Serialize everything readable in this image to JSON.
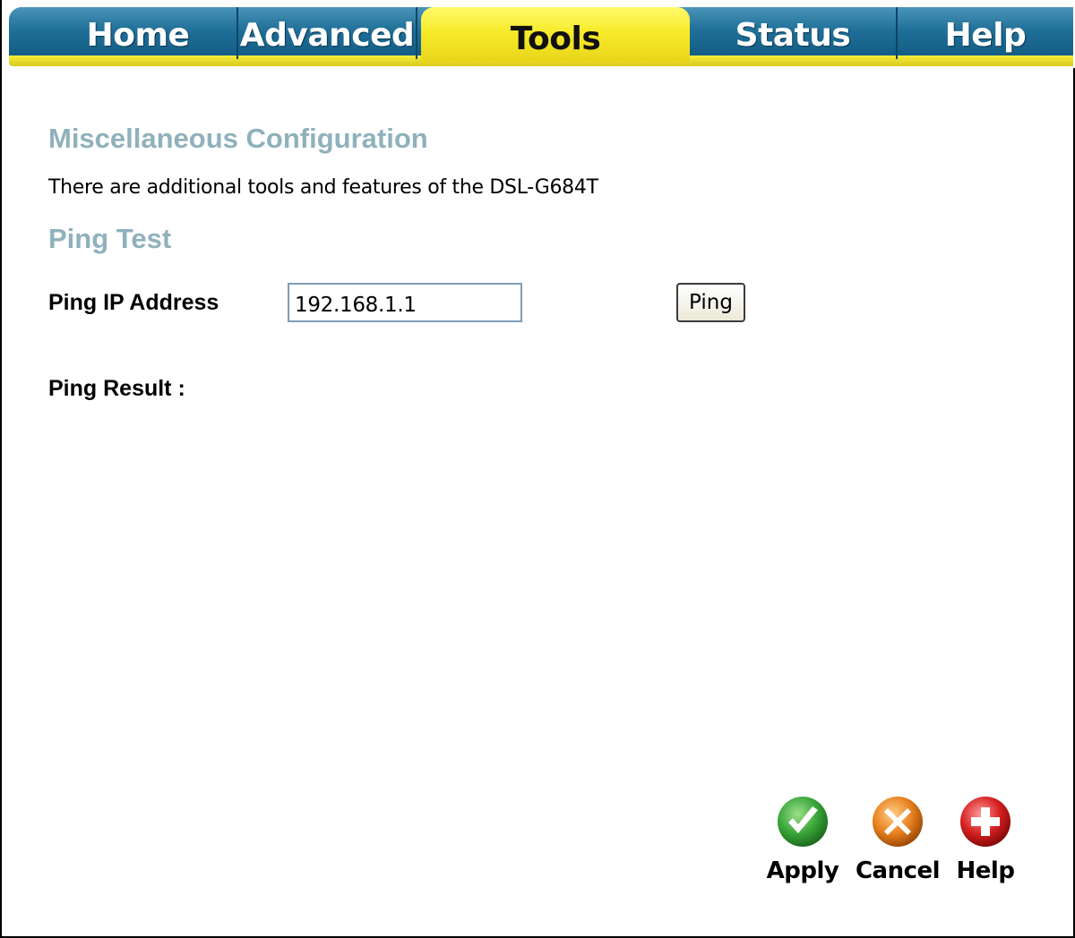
{
  "tabs": {
    "home": "Home",
    "advanced": "Advanced",
    "tools": "Tools",
    "status": "Status",
    "help": "Help",
    "active": "Tools"
  },
  "misc": {
    "title": "Miscellaneous Configuration",
    "description": "There are additional tools and features of the DSL-G684T"
  },
  "ping": {
    "title": "Ping Test",
    "ip_label": "Ping IP Address",
    "ip_value": "192.168.1.1",
    "button_label": "Ping",
    "result_label": "Ping Result :"
  },
  "actions": {
    "apply_label": "Apply",
    "cancel_label": "Cancel",
    "help_label": "Help"
  },
  "icons": {
    "apply": "check-icon",
    "cancel": "x-icon",
    "help": "plus-icon"
  },
  "colors": {
    "tab_blue": "#1f6f98",
    "tab_active_yellow": "#f7ea2a",
    "section_title": "#8fb1bb",
    "apply_green": "#3aa63a",
    "cancel_orange": "#e8801e",
    "help_red": "#d62020"
  }
}
